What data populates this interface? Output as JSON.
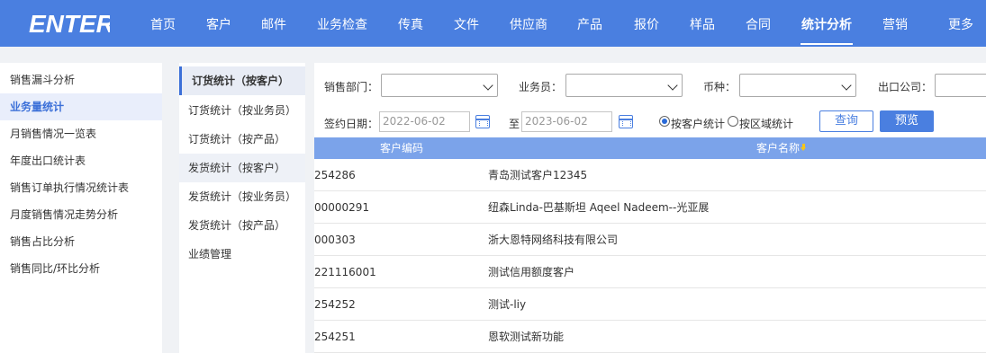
{
  "brand": {
    "logo_text": "ENTER",
    "nav_bg": "#4a7fe0"
  },
  "nav": [
    {
      "label": "首页"
    },
    {
      "label": "客户"
    },
    {
      "label": "邮件"
    },
    {
      "label": "业务检查"
    },
    {
      "label": "传真"
    },
    {
      "label": "文件"
    },
    {
      "label": "供应商"
    },
    {
      "label": "产品"
    },
    {
      "label": "报价"
    },
    {
      "label": "样品"
    },
    {
      "label": "合同"
    },
    {
      "label": "统计分析"
    },
    {
      "label": "营销"
    },
    {
      "label": "更多"
    }
  ],
  "nav_active": "统计分析",
  "sidebar": {
    "items": [
      {
        "label": "销售漏斗分析"
      },
      {
        "label": "业务量统计"
      },
      {
        "label": "月销售情况一览表"
      },
      {
        "label": "年度出口统计表"
      },
      {
        "label": "销售订单执行情况统计表"
      },
      {
        "label": "月度销售情况走势分析"
      },
      {
        "label": "销售占比分析"
      },
      {
        "label": "销售同比/环比分析"
      }
    ],
    "active": "业务量统计"
  },
  "subnav": {
    "items": [
      {
        "label": "订货统计（按客户）"
      },
      {
        "label": "订货统计（按业务员）"
      },
      {
        "label": "订货统计（按产品）"
      },
      {
        "label": "发货统计（按客户）"
      },
      {
        "label": "发货统计（按业务员）"
      },
      {
        "label": "发货统计（按产品）"
      },
      {
        "label": "业绩管理"
      }
    ],
    "active": "订货统计（按客户）"
  },
  "filters": {
    "dept_label": "销售部门：",
    "dept_value": "",
    "salesman_label": "业务员：",
    "salesman_value": "",
    "currency_label": "币种：",
    "currency_value": "",
    "export_company_label": "出口公司：",
    "export_company_value": "",
    "date_label": "签约日期：",
    "date_from": "2022-06-02",
    "to_label": "至",
    "date_to": "2023-06-02",
    "radio_by_customer": "按客户统计",
    "radio_by_region": "按区域统计",
    "radio_selected": "按客户统计",
    "query_button": "查询",
    "preview_button": "预览"
  },
  "table": {
    "columns": [
      "客户编码",
      "客户名称"
    ],
    "sorted_column": "客户名称",
    "rows": [
      {
        "code": "254286",
        "name": "青岛测试客户12345"
      },
      {
        "code": "00000291",
        "name": "纽森Linda-巴基斯坦 Aqeel Nadeem--光亚展"
      },
      {
        "code": "000303",
        "name": "浙大恩特网络科技有限公司"
      },
      {
        "code": "221116001",
        "name": "测试信用额度客户"
      },
      {
        "code": "254252",
        "name": "测试-liy"
      },
      {
        "code": "254251",
        "name": "恩软测试新功能"
      }
    ]
  }
}
